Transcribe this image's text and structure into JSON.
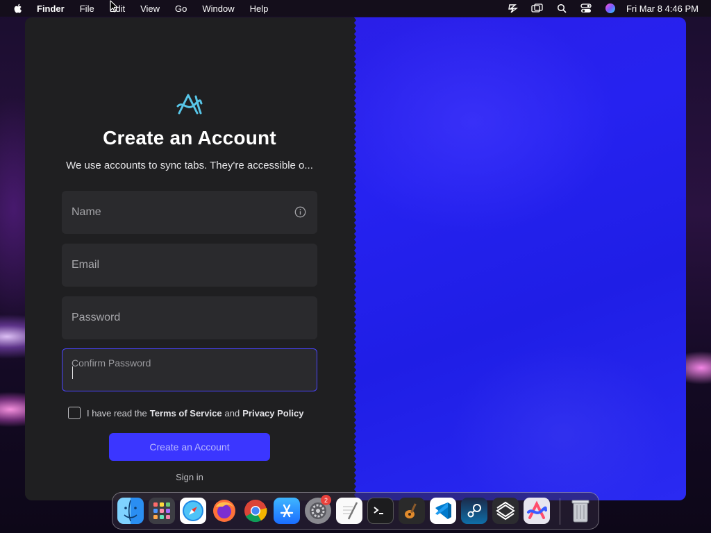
{
  "menubar": {
    "app_name": "Finder",
    "items": [
      "File",
      "Edit",
      "View",
      "Go",
      "Window",
      "Help"
    ],
    "clock": "Fri Mar 8  4:46 PM",
    "icons": [
      "apple-icon",
      "stripe-icon",
      "screen-mirror-icon",
      "search-icon",
      "control-center-icon",
      "siri-icon"
    ]
  },
  "signup": {
    "title": "Create an Account",
    "subtitle": "We use accounts to sync tabs. They're accessible o...",
    "name_placeholder": "Name",
    "email_placeholder": "Email",
    "password_placeholder": "Password",
    "confirm_label": "Confirm Password",
    "terms_prefix": "I have read the",
    "terms_link": "Terms of Service",
    "terms_and": "and",
    "privacy_link": "Privacy Policy",
    "create_button": "Create an Account",
    "signin_link": "Sign in"
  },
  "colors": {
    "accent": "#3b36ff",
    "panel_bg": "#1f1f21",
    "field_bg": "#2a2a2d",
    "gradient_blue": "#2622f0"
  },
  "dock": {
    "apps": [
      "Finder",
      "Launchpad",
      "Safari",
      "Firefox",
      "Chrome",
      "App Store",
      "System Settings",
      "TextEdit",
      "Terminal",
      "GarageBand",
      "Visual Studio Code",
      "Steam",
      "Sketch",
      "Arc",
      "Trash"
    ],
    "settings_badge": "2"
  }
}
